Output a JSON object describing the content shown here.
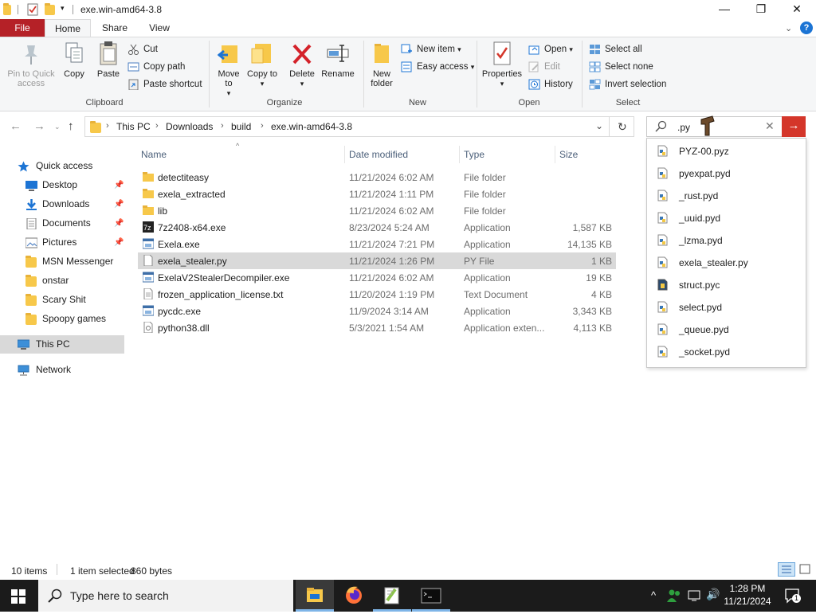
{
  "window": {
    "title": "exe.win-amd64-3.8",
    "minimize": "—",
    "maximize": "❐",
    "close": "✕"
  },
  "menu_tabs": [
    "File",
    "Home",
    "Share",
    "View"
  ],
  "ribbon": {
    "clipboard": {
      "label": "Clipboard",
      "pin_quick_access": "Pin to Quick access",
      "copy": "Copy",
      "paste": "Paste",
      "cut": "Cut",
      "copy_path": "Copy path",
      "paste_shortcut": "Paste shortcut"
    },
    "organize": {
      "label": "Organize",
      "move_to": "Move to",
      "copy_to": "Copy to",
      "delete": "Delete",
      "rename": "Rename"
    },
    "new": {
      "label": "New",
      "new_folder": "New folder",
      "new_item": "New item",
      "easy_access": "Easy access"
    },
    "open": {
      "label": "Open",
      "properties": "Properties",
      "open": "Open",
      "edit": "Edit",
      "history": "History"
    },
    "select": {
      "label": "Select",
      "select_all": "Select all",
      "select_none": "Select none",
      "invert_selection": "Invert selection"
    }
  },
  "address": {
    "breadcrumbs": [
      "This PC",
      "Downloads",
      "build",
      "exe.win-amd64-3.8"
    ],
    "search_value": ".py"
  },
  "nav_pane": {
    "quick_access": "Quick access",
    "items": [
      {
        "label": "Desktop",
        "pinned": true
      },
      {
        "label": "Downloads",
        "pinned": true
      },
      {
        "label": "Documents",
        "pinned": true
      },
      {
        "label": "Pictures",
        "pinned": true
      },
      {
        "label": "MSN Messenger",
        "pinned": false
      },
      {
        "label": "onstar",
        "pinned": false
      },
      {
        "label": "Scary Shit",
        "pinned": false
      },
      {
        "label": "Spoopy games",
        "pinned": false
      }
    ],
    "this_pc": "This PC",
    "network": "Network"
  },
  "file_list": {
    "columns": [
      "Name",
      "Date modified",
      "Type",
      "Size"
    ],
    "rows": [
      {
        "name": "detectiteasy",
        "date": "11/21/2024 6:02 AM",
        "type": "File folder",
        "size": "",
        "icon": "folder-icon"
      },
      {
        "name": "exela_extracted",
        "date": "11/21/2024 1:11 PM",
        "type": "File folder",
        "size": "",
        "icon": "folder-icon"
      },
      {
        "name": "lib",
        "date": "11/21/2024 6:02 AM",
        "type": "File folder",
        "size": "",
        "icon": "folder-icon"
      },
      {
        "name": "7z2408-x64.exe",
        "date": "8/23/2024 5:24 AM",
        "type": "Application",
        "size": "1,587 KB",
        "icon": "7zip-icon"
      },
      {
        "name": "Exela.exe",
        "date": "11/21/2024 7:21 PM",
        "type": "Application",
        "size": "14,135 KB",
        "icon": "app-icon"
      },
      {
        "name": "exela_stealer.py",
        "date": "11/21/2024 1:26 PM",
        "type": "PY File",
        "size": "1 KB",
        "icon": "file-icon"
      },
      {
        "name": "ExelaV2StealerDecompiler.exe",
        "date": "11/21/2024 6:02 AM",
        "type": "Application",
        "size": "19 KB",
        "icon": "app-icon"
      },
      {
        "name": "frozen_application_license.txt",
        "date": "11/20/2024 1:19 PM",
        "type": "Text Document",
        "size": "4 KB",
        "icon": "text-file-icon"
      },
      {
        "name": "pycdc.exe",
        "date": "11/9/2024 3:14 AM",
        "type": "Application",
        "size": "3,343 KB",
        "icon": "app-icon"
      },
      {
        "name": "python38.dll",
        "date": "5/3/2021 1:54 AM",
        "type": "Application exten...",
        "size": "4,113 KB",
        "icon": "dll-icon"
      }
    ],
    "selected_row": "exela_stealer.py"
  },
  "search_suggestions": [
    "PYZ-00.pyz",
    "pyexpat.pyd",
    "_rust.pyd",
    "_uuid.pyd",
    "_lzma.pyd",
    "exela_stealer.py",
    "struct.pyc",
    "select.pyd",
    "_queue.pyd",
    "_socket.pyd"
  ],
  "status_bar": {
    "item_count": "10 items",
    "selection": "1 item selected",
    "size": "860 bytes"
  },
  "taskbar": {
    "search_placeholder": "Type here to search",
    "time": "1:28 PM",
    "date": "11/21/2024",
    "notification_count": "1"
  },
  "colors": {
    "file_tab": "#b52127",
    "search_go": "#d4362a",
    "folder": "#f7c84a",
    "selection": "#d9d9d9",
    "taskbar": "#1b1b1b"
  }
}
